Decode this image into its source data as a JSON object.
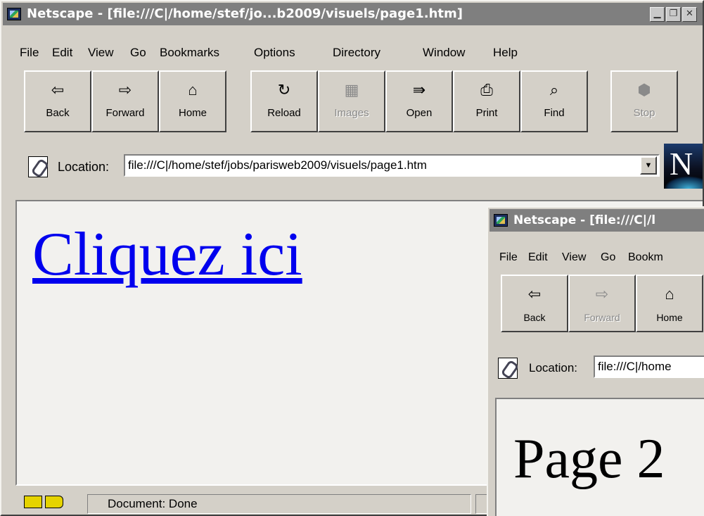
{
  "main_window": {
    "title": "Netscape - [file:///C|/home/stef/jo...b2009/visuels/page1.htm]",
    "menu": [
      {
        "label": "File"
      },
      {
        "label": "Edit"
      },
      {
        "label": "View"
      },
      {
        "label": "Go"
      },
      {
        "label": "Bookmarks"
      },
      {
        "label": "Options"
      },
      {
        "label": "Directory"
      },
      {
        "label": "Window"
      },
      {
        "label": "Help"
      }
    ],
    "toolbar": [
      {
        "label": "Back",
        "icon": "back-arrow-icon",
        "glyph": "⇦",
        "enabled": true
      },
      {
        "label": "Forward",
        "icon": "forward-arrow-icon",
        "glyph": "⇨",
        "enabled": true
      },
      {
        "label": "Home",
        "icon": "home-icon",
        "glyph": "⌂",
        "enabled": true
      },
      {
        "label": "Reload",
        "icon": "reload-icon",
        "glyph": "↻",
        "enabled": true
      },
      {
        "label": "Images",
        "icon": "images-icon",
        "glyph": "▦",
        "enabled": false
      },
      {
        "label": "Open",
        "icon": "open-icon",
        "glyph": "⇛",
        "enabled": true
      },
      {
        "label": "Print",
        "icon": "print-icon",
        "glyph": "⎙",
        "enabled": true
      },
      {
        "label": "Find",
        "icon": "find-icon",
        "glyph": "⌕",
        "enabled": true
      },
      {
        "label": "Stop",
        "icon": "stop-icon",
        "glyph": "⬢",
        "enabled": false
      }
    ],
    "location": {
      "label": "Location:",
      "url": "file:///C|/home/stef/jobs/parisweb2009/visuels/page1.htm"
    },
    "throbber_letter": "N",
    "content": {
      "link_text": "Cliquez ici"
    },
    "status": "Document: Done"
  },
  "sub_window": {
    "title": "Netscape - [file:///C|/l",
    "menu": [
      {
        "label": "File"
      },
      {
        "label": "Edit"
      },
      {
        "label": "View"
      },
      {
        "label": "Go"
      },
      {
        "label": "Bookm"
      }
    ],
    "toolbar": [
      {
        "label": "Back",
        "icon": "back-arrow-icon",
        "glyph": "⇦",
        "enabled": true
      },
      {
        "label": "Forward",
        "icon": "forward-arrow-icon",
        "glyph": "⇨",
        "enabled": false
      },
      {
        "label": "Home",
        "icon": "home-icon",
        "glyph": "⌂",
        "enabled": true
      }
    ],
    "location": {
      "label": "Location:",
      "url": "file:///C|/home"
    },
    "content": {
      "heading": "Page 2"
    }
  }
}
